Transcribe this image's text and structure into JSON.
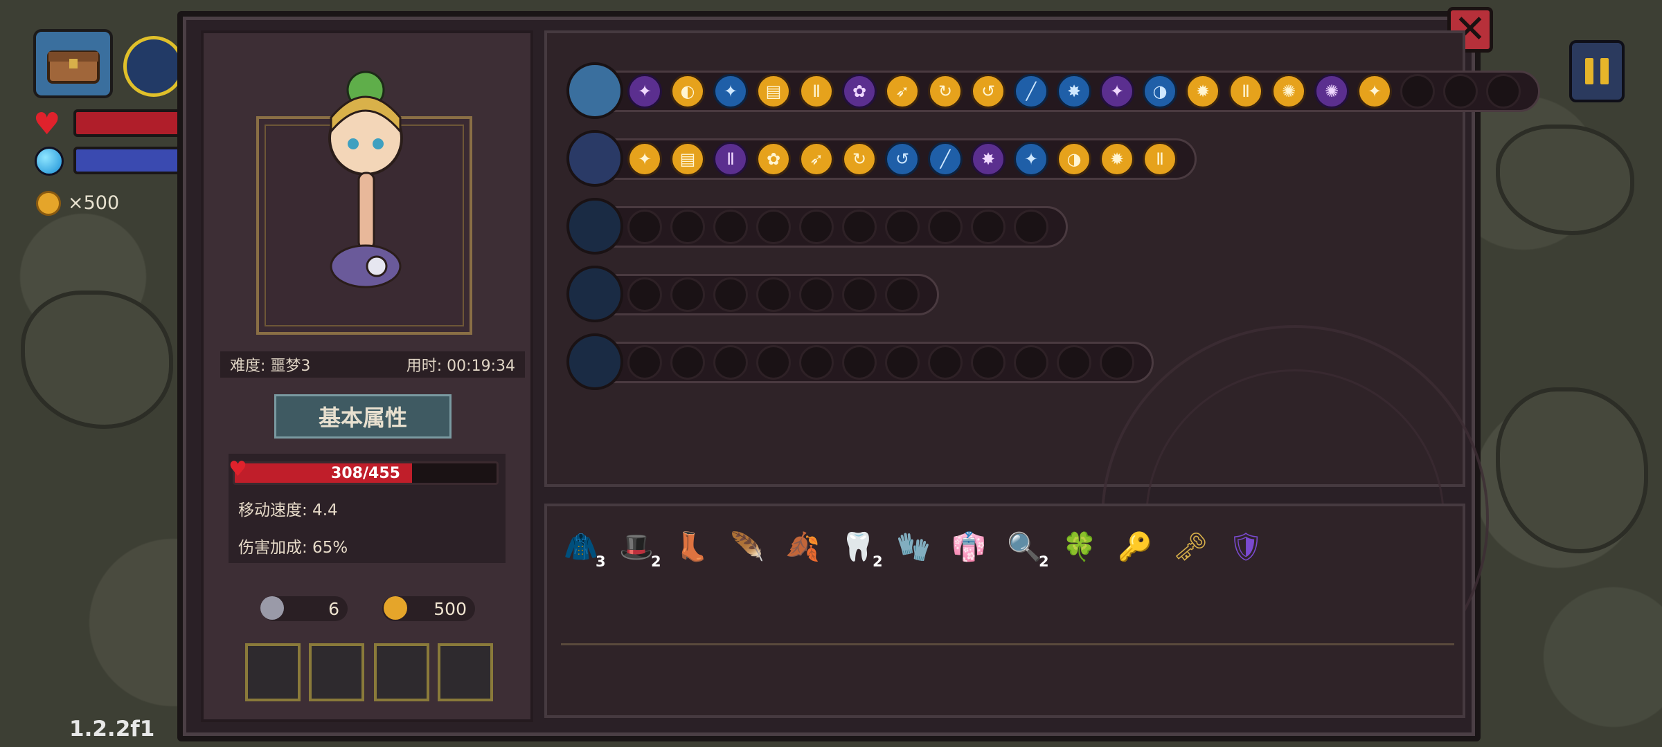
{
  "hud": {
    "coin_text": "×500",
    "version": "1.2.2f1"
  },
  "character": {
    "difficulty": "难度: 噩梦3",
    "time_used": "用时: 00:19:34",
    "section_title": "基本属性",
    "hp_text": "308/455",
    "hp_fraction": 0.677,
    "move_speed": "移动速度: 4.4",
    "damage_bonus": "伤害加成: 65%",
    "keys": "6",
    "gold": "500"
  },
  "weapon_rows": [
    {
      "icon": "chest-icon",
      "filled": 18,
      "empty": 3
    },
    {
      "icon": "spellbook-icon",
      "filled": 13,
      "empty": 0
    },
    {
      "icon": "dagger-icon",
      "filled": 0,
      "empty": 10
    },
    {
      "icon": "spear-icon",
      "filled": 0,
      "empty": 7
    },
    {
      "icon": "mace-icon",
      "filled": 0,
      "empty": 12
    }
  ],
  "items": [
    {
      "name": "cloak-icon",
      "count": "3"
    },
    {
      "name": "wizard-hat-icon",
      "count": "2"
    },
    {
      "name": "boot-icon",
      "count": ""
    },
    {
      "name": "feather-icon",
      "count": ""
    },
    {
      "name": "leaf-icon",
      "count": ""
    },
    {
      "name": "fangs-icon",
      "count": "2"
    },
    {
      "name": "gauntlet-icon",
      "count": ""
    },
    {
      "name": "robe-icon",
      "count": ""
    },
    {
      "name": "magnifier-icon",
      "count": "2"
    },
    {
      "name": "clover-icon",
      "count": ""
    },
    {
      "name": "key-icon",
      "count": ""
    },
    {
      "name": "bone-key-icon",
      "count": ""
    },
    {
      "name": "rainbow-shield-icon",
      "count": ""
    }
  ],
  "colors": {
    "accent_gold": "#e6a21c",
    "hp_red": "#c01e2a",
    "panel_bg": "#2f2328"
  }
}
